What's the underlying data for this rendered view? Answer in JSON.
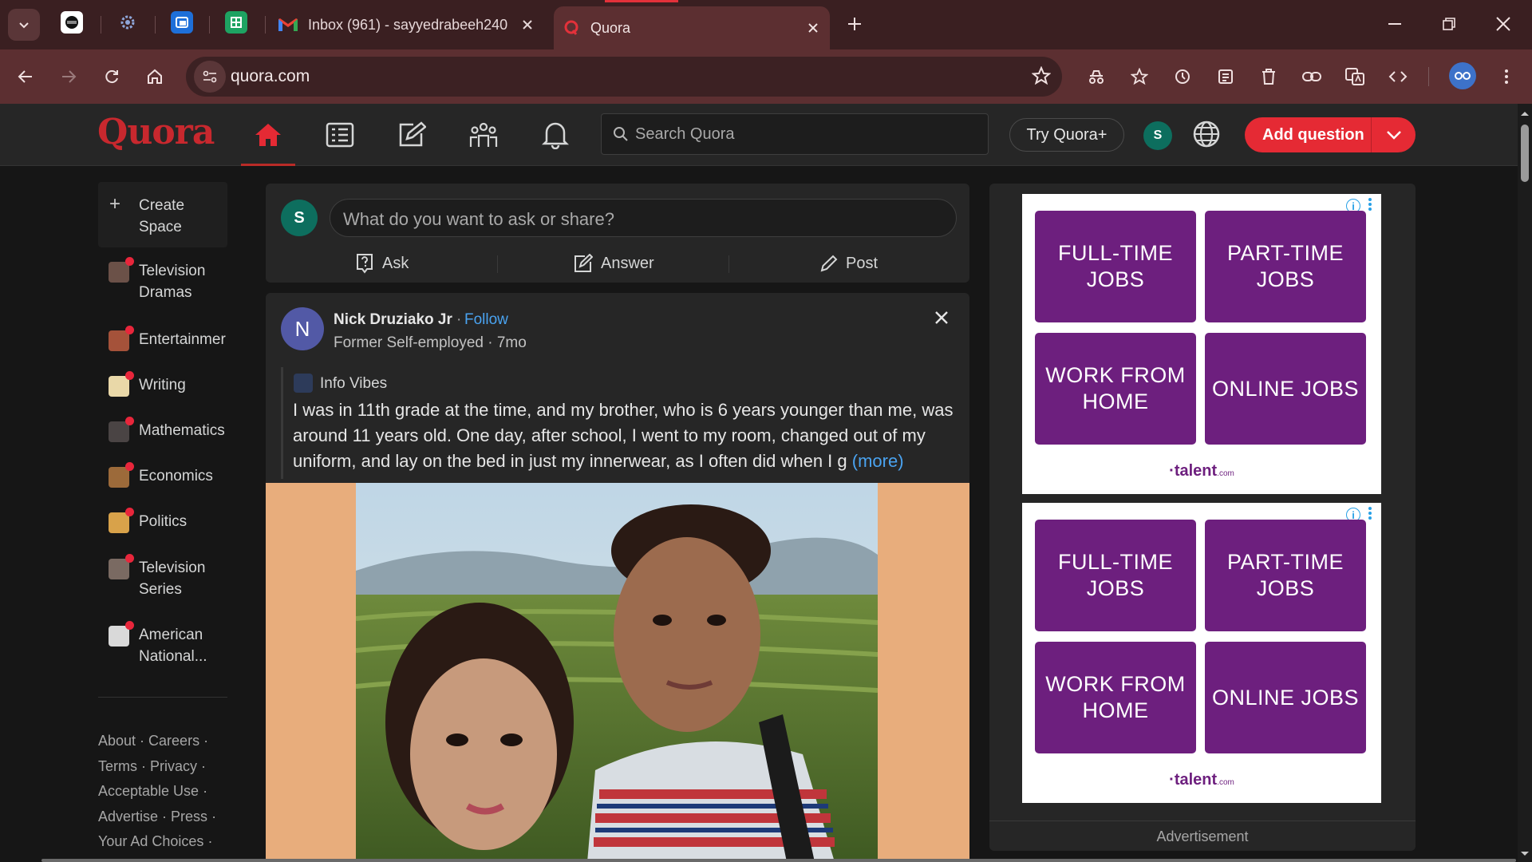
{
  "browser": {
    "tabs": [
      {
        "title": "Inbox (961) - sayyedrabeeh240"
      },
      {
        "title": "Quora"
      }
    ],
    "url": "quora.com"
  },
  "quora": {
    "logo": "Quora",
    "search_placeholder": "Search Quora",
    "try_plus": "Try Quora+",
    "user_initial": "S",
    "add_question": "Add question",
    "accent_color": "#e52a34"
  },
  "sidebar": {
    "create_space": "Create Space",
    "spaces": [
      {
        "label": "Television Dramas"
      },
      {
        "label": "Entertainmer"
      },
      {
        "label": "Writing"
      },
      {
        "label": "Mathematics"
      },
      {
        "label": "Economics"
      },
      {
        "label": "Politics"
      },
      {
        "label": "Television Series"
      },
      {
        "label": "American National..."
      }
    ],
    "footer": [
      "About",
      "Careers",
      "Terms",
      "Privacy",
      "Acceptable Use",
      "Advertise",
      "Press",
      "Your Ad Choices"
    ]
  },
  "ask": {
    "avatar": "S",
    "placeholder": "What do you want to ask or share?",
    "actions": [
      "Ask",
      "Answer",
      "Post"
    ]
  },
  "post": {
    "avatar": "N",
    "author": "Nick Druziako Jr",
    "dot": "·",
    "follow": "Follow",
    "meta": "Former Self-employed · 7mo",
    "space": "Info Vibes",
    "text": "I was in 11th grade at the time, and my brother, who is 6 years younger than me, was around 11 years old. One day, after school, I went to my room, changed out of my uniform, and lay on the bed in just my innerwear, as I often did when I g",
    "more": "(more)"
  },
  "ads": [
    {
      "tiles": [
        "FULL-TIME JOBS",
        "PART-TIME JOBS",
        "WORK FROM HOME",
        "ONLINE JOBS"
      ],
      "brand": "talent",
      "brand_suffix": ".com"
    },
    {
      "tiles": [
        "FULL-TIME JOBS",
        "PART-TIME JOBS",
        "WORK FROM HOME",
        "ONLINE JOBS"
      ],
      "brand": "talent",
      "brand_suffix": ".com"
    }
  ],
  "advertisement_label": "Advertisement"
}
